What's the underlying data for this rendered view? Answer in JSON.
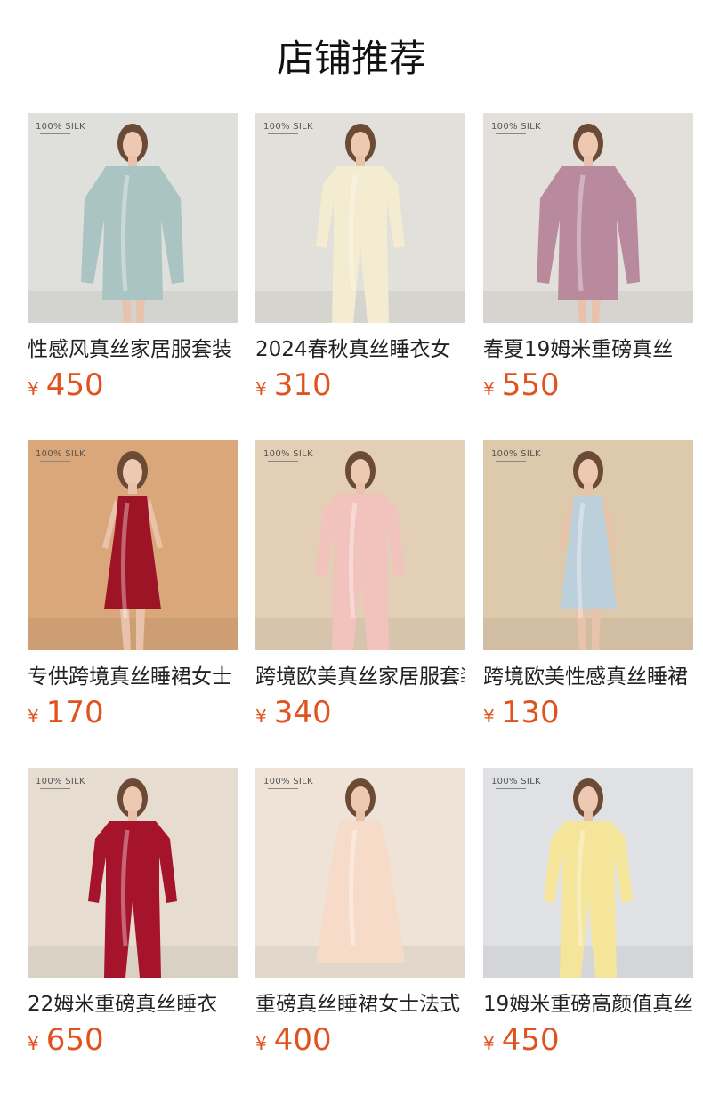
{
  "section_title": "店铺推荐",
  "brand_mark": "100% SILK",
  "products": [
    {
      "name": "性感风真丝家居服套装",
      "currency": "¥",
      "price": "450",
      "bg": "#dfe0dc",
      "garment": "#a9c4c2",
      "type": "robe-dress"
    },
    {
      "name": "2024春秋真丝睡衣女",
      "currency": "¥",
      "price": "310",
      "bg": "#e2e0da",
      "garment": "#f3ecd0",
      "type": "pajama"
    },
    {
      "name": "春夏19姆米重磅真丝",
      "currency": "¥",
      "price": "550",
      "bg": "#e3e0dc",
      "garment": "#b98a9d",
      "type": "robe-dress"
    },
    {
      "name": "专供跨境真丝睡裙女士",
      "currency": "¥",
      "price": "170",
      "bg": "#d9a77a",
      "garment": "#9e1427",
      "type": "slip"
    },
    {
      "name": "跨境欧美真丝家居服套装",
      "currency": "¥",
      "price": "340",
      "bg": "#e2cfb6",
      "garment": "#f2c3bd",
      "type": "pajama"
    },
    {
      "name": "跨境欧美性感真丝睡裙",
      "currency": "¥",
      "price": "130",
      "bg": "#ddc9ab",
      "garment": "#bcd0dc",
      "type": "slip"
    },
    {
      "name": "22姆米重磅真丝睡衣",
      "currency": "¥",
      "price": "650",
      "bg": "#e6ddd0",
      "garment": "#a5142a",
      "type": "pajama"
    },
    {
      "name": "重磅真丝睡裙女士法式",
      "currency": "¥",
      "price": "400",
      "bg": "#eee3d6",
      "garment": "#f6dcc8",
      "type": "nightgown"
    },
    {
      "name": "19姆米重磅高颜值真丝",
      "currency": "¥",
      "price": "450",
      "bg": "#dfe1e4",
      "garment": "#f5e59a",
      "type": "pajama"
    }
  ]
}
